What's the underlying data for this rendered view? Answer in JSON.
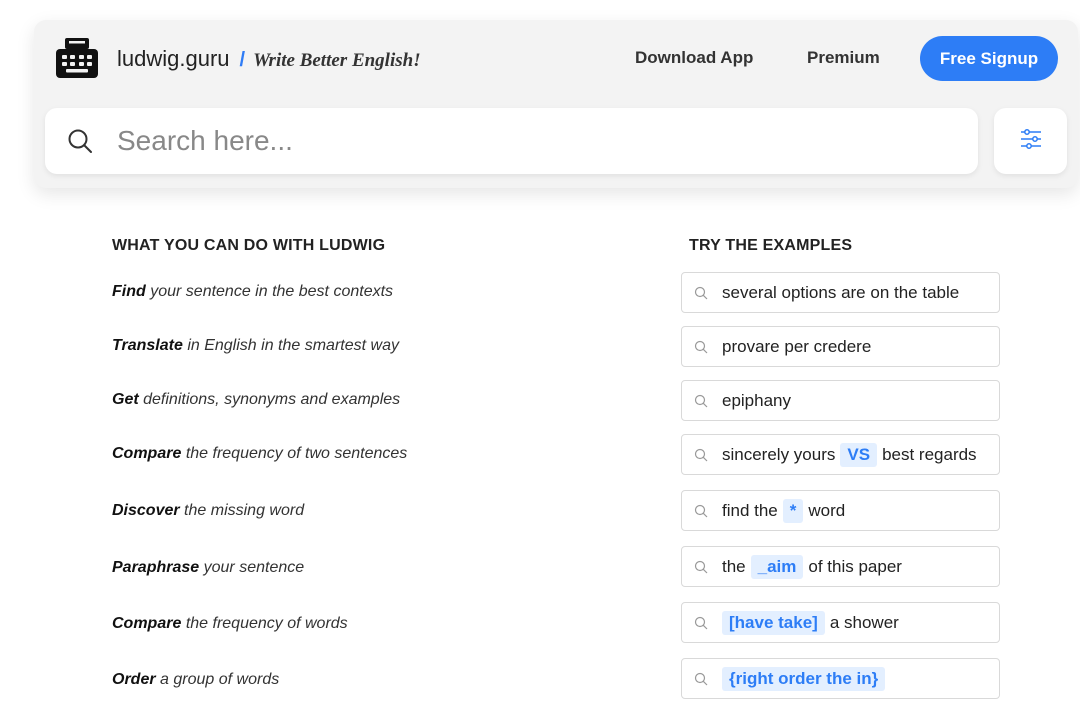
{
  "brand": {
    "name": "ludwig.guru",
    "slash": "/",
    "tagline": "Write Better English!"
  },
  "nav": {
    "download": "Download App",
    "premium": "Premium",
    "signup": "Free Signup"
  },
  "search": {
    "placeholder": "Search here...",
    "value": ""
  },
  "features": {
    "heading": "WHAT YOU CAN DO WITH LUDWIG",
    "items": [
      {
        "verb": "Find",
        "rest": "your sentence in the best contexts"
      },
      {
        "verb": "Translate",
        "rest": "in English in the smartest way"
      },
      {
        "verb": "Get",
        "rest": "definitions, synonyms and examples"
      },
      {
        "verb": "Compare",
        "rest": "the frequency of two sentences"
      },
      {
        "verb": "Discover",
        "rest": "the missing word"
      },
      {
        "verb": "Paraphrase",
        "rest": "your sentence"
      },
      {
        "verb": "Compare",
        "rest": "the frequency of words"
      },
      {
        "verb": "Order",
        "rest": "a group of words"
      }
    ]
  },
  "examples": {
    "heading": "TRY THE EXAMPLES",
    "items": [
      {
        "before": "several options are on the table",
        "highlight": "",
        "after": ""
      },
      {
        "before": "provare per credere",
        "highlight": "",
        "after": ""
      },
      {
        "before": "epiphany",
        "highlight": "",
        "after": ""
      },
      {
        "before": "sincerely yours",
        "highlight": "VS",
        "after": "best regards"
      },
      {
        "before": "find the",
        "highlight": "*",
        "after": "word"
      },
      {
        "before": "the",
        "highlight": "_aim",
        "after": "of this paper"
      },
      {
        "before": "",
        "highlight": "[have take]",
        "after": "a shower"
      },
      {
        "before": "",
        "highlight": "{right order the in}",
        "after": ""
      }
    ]
  },
  "colors": {
    "accent": "#2d7df6",
    "highlight_bg": "#e3efff",
    "header_bg": "#f3f3f3"
  },
  "icons": {
    "logo": "typewriter-icon",
    "search": "search-icon",
    "filter": "sliders-icon"
  }
}
